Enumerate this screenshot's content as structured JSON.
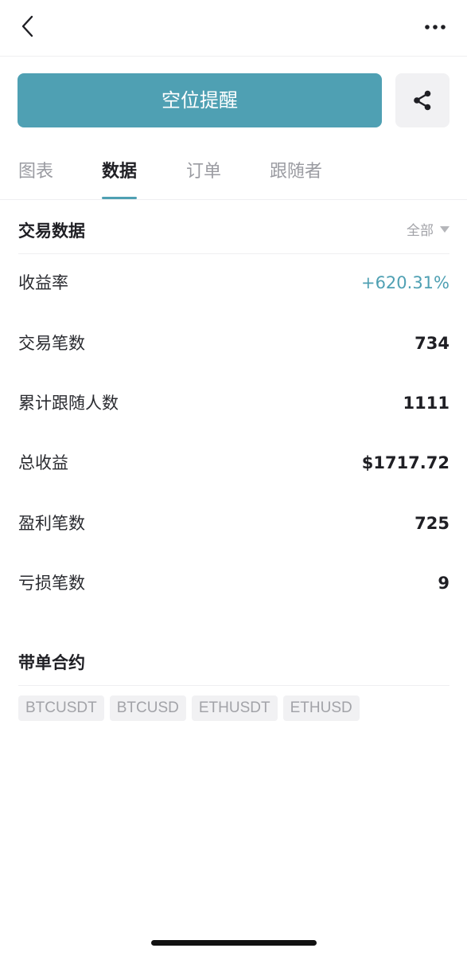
{
  "header": {
    "back_icon": "chevron-left-icon",
    "more_icon": "more-horizontal-icon"
  },
  "actions": {
    "alert_label": "空位提醒",
    "share_icon": "share-icon",
    "accent_color": "#4fa0b3"
  },
  "tabs": [
    {
      "label": "图表",
      "active": false
    },
    {
      "label": "数据",
      "active": true
    },
    {
      "label": "订单",
      "active": false
    },
    {
      "label": "跟随者",
      "active": false
    }
  ],
  "trade_data": {
    "title": "交易数据",
    "filter_label": "全部",
    "stats": [
      {
        "label": "收益率",
        "value": "+620.31%"
      },
      {
        "label": "交易笔数",
        "value": "734"
      },
      {
        "label": "累计跟随人数",
        "value": "1111"
      },
      {
        "label": "总收益",
        "value": "$1717.72"
      },
      {
        "label": "盈利笔数",
        "value": "725"
      },
      {
        "label": "亏损笔数",
        "value": "9"
      }
    ]
  },
  "contracts": {
    "title": "带单合约",
    "tags": [
      "BTCUSDT",
      "BTCUSD",
      "ETHUSDT",
      "ETHUSD"
    ]
  }
}
